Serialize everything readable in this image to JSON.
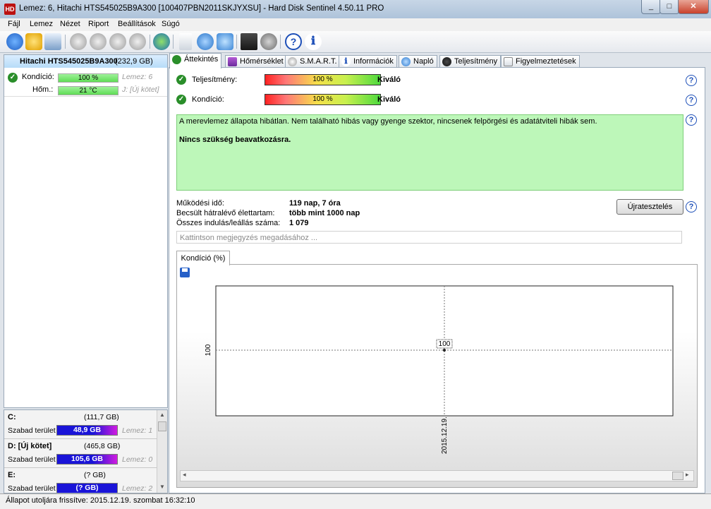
{
  "window": {
    "title": "Lemez: 6, Hitachi HTS545025B9A300 [100407PBN2011SKJYXSU]  -  Hard Disk Sentinel 4.50.11 PRO",
    "icon_text": "HD",
    "buttons": {
      "minimize": "_",
      "restore": "□",
      "close": "✕"
    }
  },
  "menu": [
    "Fájl",
    "Lemez",
    "Nézet",
    "Riport",
    "Beállítások",
    "Súgó"
  ],
  "toolbar_icons": [
    "refresh-icon",
    "warning-icon",
    "report-icon",
    "disk-icon-1",
    "disk-icon-2",
    "disk-icon-3",
    "disk-icon-4",
    "globe-icon",
    "document-icon",
    "sync-icon",
    "network-icon",
    "monitor-icon",
    "speaker-icon",
    "help-icon",
    "info-icon"
  ],
  "disk": {
    "name": "Hitachi HTS545025B9A300",
    "size": "(232,9 GB)",
    "condition_label": "Kondíció:",
    "condition_value": "100 %",
    "condition_level": 100,
    "disk_ref": "Lemez: 6",
    "temp_label": "Hőm.:",
    "temp_value": "21 °C",
    "volume_ref": "J: [Új kötet]"
  },
  "volumes": [
    {
      "letter": "C:",
      "size": "(111,7 GB)",
      "free_label": "Szabad terület",
      "free": "48,9 GB",
      "disk_ref": "Lemez: 1"
    },
    {
      "letter": "D: [Új kötet]",
      "size": "(465,8 GB)",
      "free_label": "Szabad terület",
      "free": "105,6 GB",
      "disk_ref": "Lemez: 0"
    },
    {
      "letter": "E:",
      "size": "(? GB)",
      "free_label": "Szabad terület",
      "free": "(? GB)",
      "disk_ref": "Lemez: 2"
    }
  ],
  "tabs": [
    "Áttekintés",
    "Hőmérséklet",
    "S.M.A.R.T.",
    "Információk",
    "Napló",
    "Teljesítmény",
    "Figyelmeztetések"
  ],
  "overview": {
    "performance_label": "Teljesítmény:",
    "performance_value": "100 %",
    "performance_level": 100,
    "performance_rating": "Kiváló",
    "condition_label": "Kondíció:",
    "condition_value": "100 %",
    "condition_level": 100,
    "condition_rating": "Kiváló",
    "status_text": "A merevlemez állapota hibátlan. Nem található hibás vagy gyenge szektor, nincsenek felpörgési és adatátviteli hibák sem.",
    "status_bold": "Nincs szükség beavatkozásra.",
    "stats": [
      {
        "label": "Működési idő:",
        "value": "119 nap, 7 óra"
      },
      {
        "label": "Becsült hátralévő élettartam:",
        "value": "több mint 1000 nap"
      },
      {
        "label": "Összes indulás/leállás száma:",
        "value": "1 079"
      }
    ],
    "retest_button": "Újratesztelés",
    "comment_placeholder": "Kattintson megjegyzés megadásához ...",
    "chart_tab": "Kondíció  (%)"
  },
  "chart_data": {
    "type": "line",
    "x": [
      "2015.12.19."
    ],
    "series": [
      {
        "values": [
          100
        ]
      }
    ],
    "ylabel": "",
    "xlabel": "",
    "y_tick_labels": [
      "100"
    ],
    "x_tick_labels": [
      "2015.12.19."
    ],
    "data_labels": [
      "100"
    ],
    "grid": true
  },
  "statusbar": {
    "text": "Állapot utoljára frissítve: 2015.12.19. szombat 16:32:10"
  }
}
